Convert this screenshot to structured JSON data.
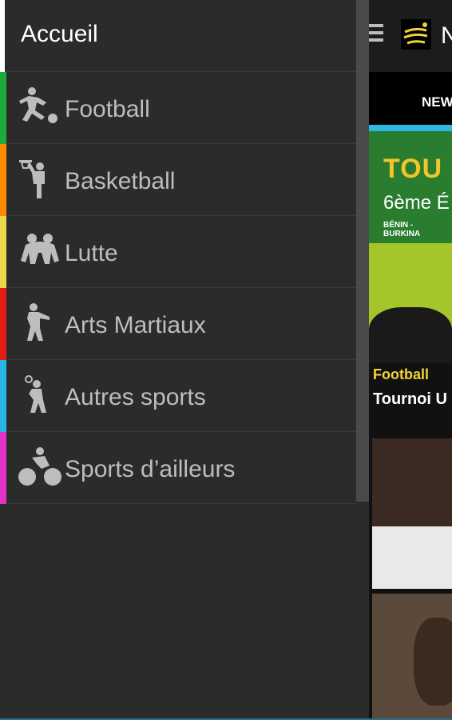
{
  "drawer": {
    "home_label": "Accueil",
    "items": [
      {
        "label": "Football",
        "color": "#1faa3c",
        "icon": "football-player-icon"
      },
      {
        "label": "Basketball",
        "color": "#ff8a00",
        "icon": "basketball-player-icon"
      },
      {
        "label": "Lutte",
        "color": "#e8d84a",
        "icon": "wrestling-icon"
      },
      {
        "label": "Arts Martiaux",
        "color": "#e41b17",
        "icon": "martial-arts-icon"
      },
      {
        "label": "Autres sports",
        "color": "#28b6e6",
        "icon": "tennis-player-icon"
      },
      {
        "label": "Sports d’ailleurs",
        "color": "#e431c8",
        "icon": "cycling-icon"
      }
    ]
  },
  "content": {
    "appbar_title_partial": "N",
    "tab_label": "NEWS",
    "hero": {
      "title": "TOU",
      "edition": "6ème É",
      "countries": "BÉNIN - BURKINA"
    },
    "article": {
      "category": "Football",
      "title": "Tournoi U"
    }
  }
}
